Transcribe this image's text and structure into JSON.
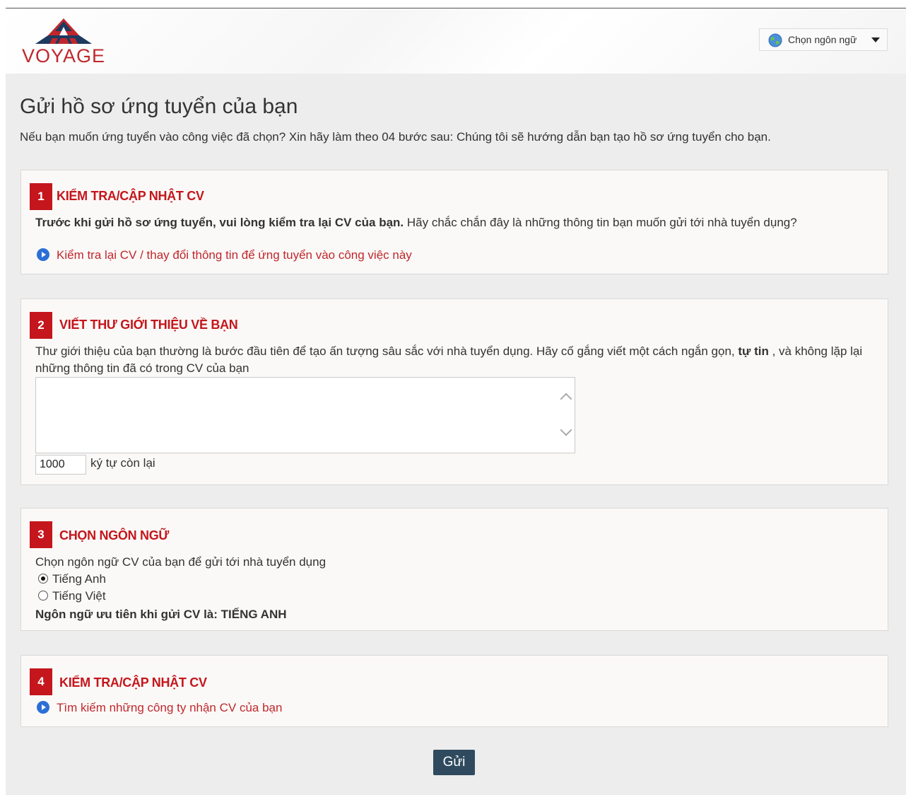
{
  "header": {
    "logo_text": "VOYAGE",
    "language_selector": "Chọn ngôn ngữ"
  },
  "page": {
    "title": "Gửi hồ sơ ứng tuyển của bạn",
    "intro": "Nếu bạn muốn ứng tuyển vào công việc đã chọn? Xin hãy làm theo 04 bước sau: Chúng tôi sẽ hướng dẫn bạn tạo hồ sơ ứng tuyển cho bạn."
  },
  "step1": {
    "number": "1",
    "title": "KIỂM TRA/CẬP NHẬT CV",
    "bold_text": "Trước khi gửi hồ sơ ứng tuyển, vui lòng kiểm tra lại CV của bạn.",
    "text": " Hãy chắc chắn đây là những thông tin bạn muốn gửi tới nhà tuyển dụng?",
    "link": "Kiểm tra lại CV / thay đổi thông tin để ứng tuyển vào công việc này"
  },
  "step2": {
    "number": "2",
    "title": "VIẾT THƯ GIỚI THIỆU VỀ BẠN",
    "text_before": "Thư giới thiệu của bạn thường là bước đầu tiên để tạo ấn tượng sâu sắc với nhà tuyển dụng. Hãy cố gắng viết một cách ngắn gọn, ",
    "text_bold": "tự tin",
    "text_after": " , và không lặp lại những thông tin đã có trong CV của bạn",
    "cover_letter_value": "",
    "chars_remaining": "1000",
    "chars_label": "ký tự còn lại"
  },
  "step3": {
    "number": "3",
    "title": "CHỌN NGÔN NGỮ",
    "prompt": "Chọn ngôn ngữ CV của bạn để gửi tới nhà tuyển dụng",
    "options": [
      {
        "label": "Tiếng Anh",
        "checked": true
      },
      {
        "label": "Tiếng Việt",
        "checked": false
      }
    ],
    "preferred": "Ngôn ngữ ưu tiên khi gửi CV là: TIẾNG ANH"
  },
  "step4": {
    "number": "4",
    "title": "KIỂM TRA/CẬP NHẬT CV",
    "link": "Tìm kiếm những công ty nhận CV của bạn"
  },
  "submit_label": "Gửi",
  "colors": {
    "accent_red": "#c4161c",
    "link_red": "#c0272d",
    "link_icon_blue": "#2b6fd6",
    "button_bg": "#2f4a5e",
    "page_bg": "#ededed"
  }
}
